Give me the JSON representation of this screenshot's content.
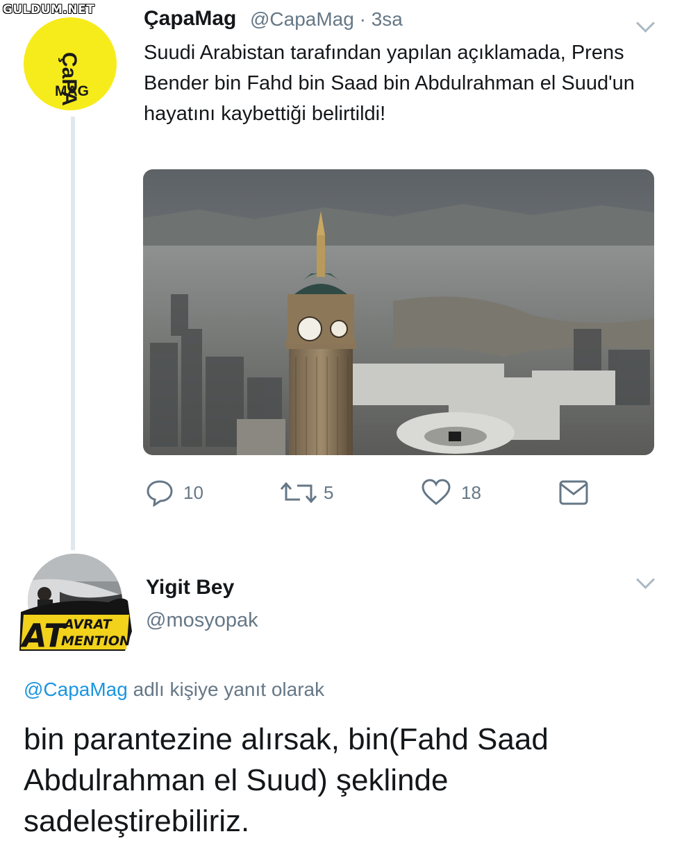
{
  "watermark": "GULDUM.NET",
  "tweet": {
    "avatar_text_top": "ÇaPA",
    "avatar_text_bottom": "MAG",
    "display_name": "ÇapaMag",
    "handle": "@CapaMag",
    "time": "· 3sa",
    "text": "Suudi Arabistan tarafından yapılan açıklamada, Prens Bender bin Fahd bin Saad bin Abdulrahman el Suud'un hayatını kaybettiği belirtildi!",
    "media_icon": "aerial-city-clock-tower-photo",
    "stats": {
      "replies": "10",
      "retweets": "5",
      "likes": "18"
    }
  },
  "reply": {
    "avatar_line1": "AVRAT",
    "avatar_line2": "MENTION",
    "avatar_big": "AT",
    "display_name": "Yigit Bey",
    "handle": "@mosyopak",
    "replying_mention": "@CapaMag",
    "replying_suffix": " adlı kişiye yanıt olarak",
    "text": "bin parantezine alırsak, bin(Fahd Saad Abdulrahman el Suud) şeklinde sadeleştirebiliriz."
  },
  "colors": {
    "accent": "#1b95e0",
    "muted": "#657786",
    "avatar_yellow": "#f7ec1b"
  }
}
